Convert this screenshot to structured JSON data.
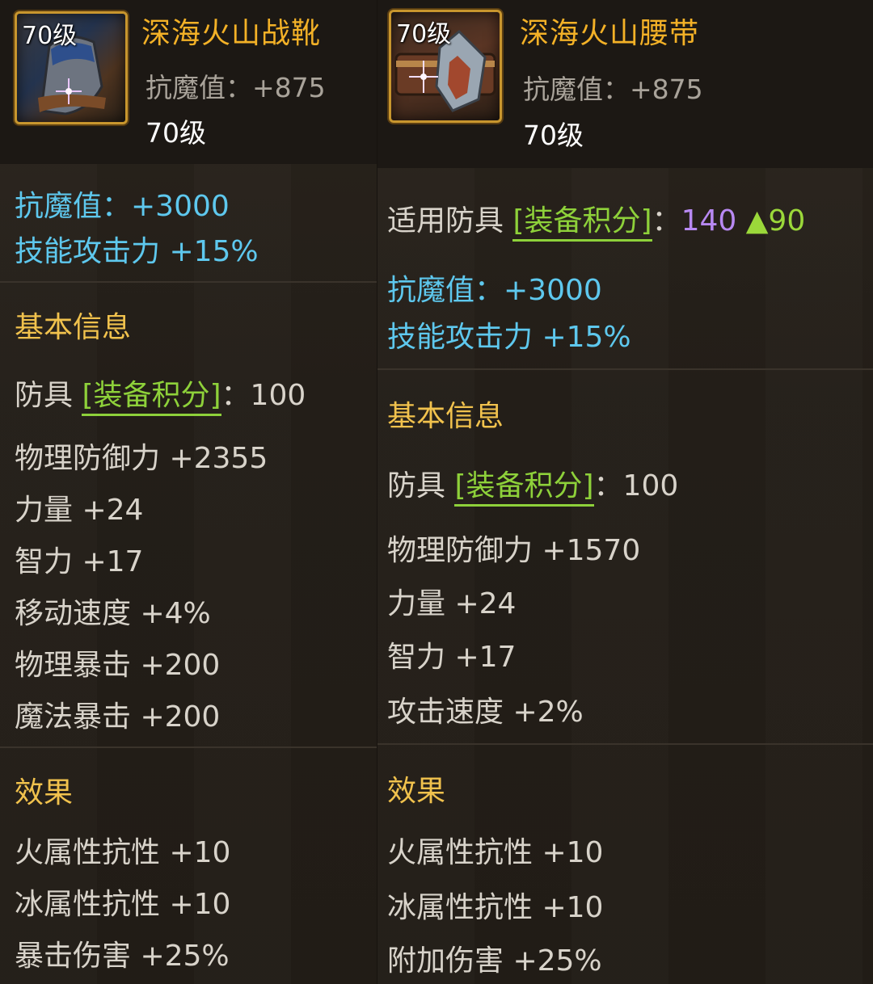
{
  "left": {
    "icon_level": "70级",
    "item_name": "深海火山战靴",
    "header_stat": "抗魔值：+875",
    "header_level": "70级",
    "bonus_lines": [
      "抗魔值：+3000",
      "技能攻击力 +15%"
    ],
    "basic_title": "基本信息",
    "score": {
      "prefix": "防具 ",
      "label": "[装备积分]",
      "value": "：100"
    },
    "stats": [
      "物理防御力 +2355",
      "力量 +24",
      "智力 +17",
      "移动速度 +4%",
      "物理暴击 +200",
      "魔法暴击 +200"
    ],
    "effects_title": "效果",
    "effects": [
      "火属性抗性 +10",
      "冰属性抗性 +10",
      "暴击伤害 +25%"
    ]
  },
  "right": {
    "icon_level": "70级",
    "item_name": "深海火山腰带",
    "header_stat": "抗魔值：+875",
    "header_level": "70级",
    "applicable": {
      "prefix": "适用防具 ",
      "label": "[装备积分]",
      "colon": "：",
      "value": "140",
      "delta": "▲90"
    },
    "bonus_lines": [
      "抗魔值：+3000",
      "技能攻击力 +15%"
    ],
    "basic_title": "基本信息",
    "score": {
      "prefix": "防具 ",
      "label": "[装备积分]",
      "value": "：100"
    },
    "stats": [
      "物理防御力 +1570",
      "力量 +24",
      "智力 +17",
      "攻击速度 +2%"
    ],
    "effects_title": "效果",
    "effects": [
      "火属性抗性 +10",
      "冰属性抗性 +10",
      "附加伤害 +25%"
    ]
  },
  "colors": {
    "name_gold": "#f3b127",
    "bonus_blue": "#5ec8ee",
    "section_gold": "#f1c24d",
    "score_green": "#8ed13a",
    "value_purple": "#b889f2"
  }
}
